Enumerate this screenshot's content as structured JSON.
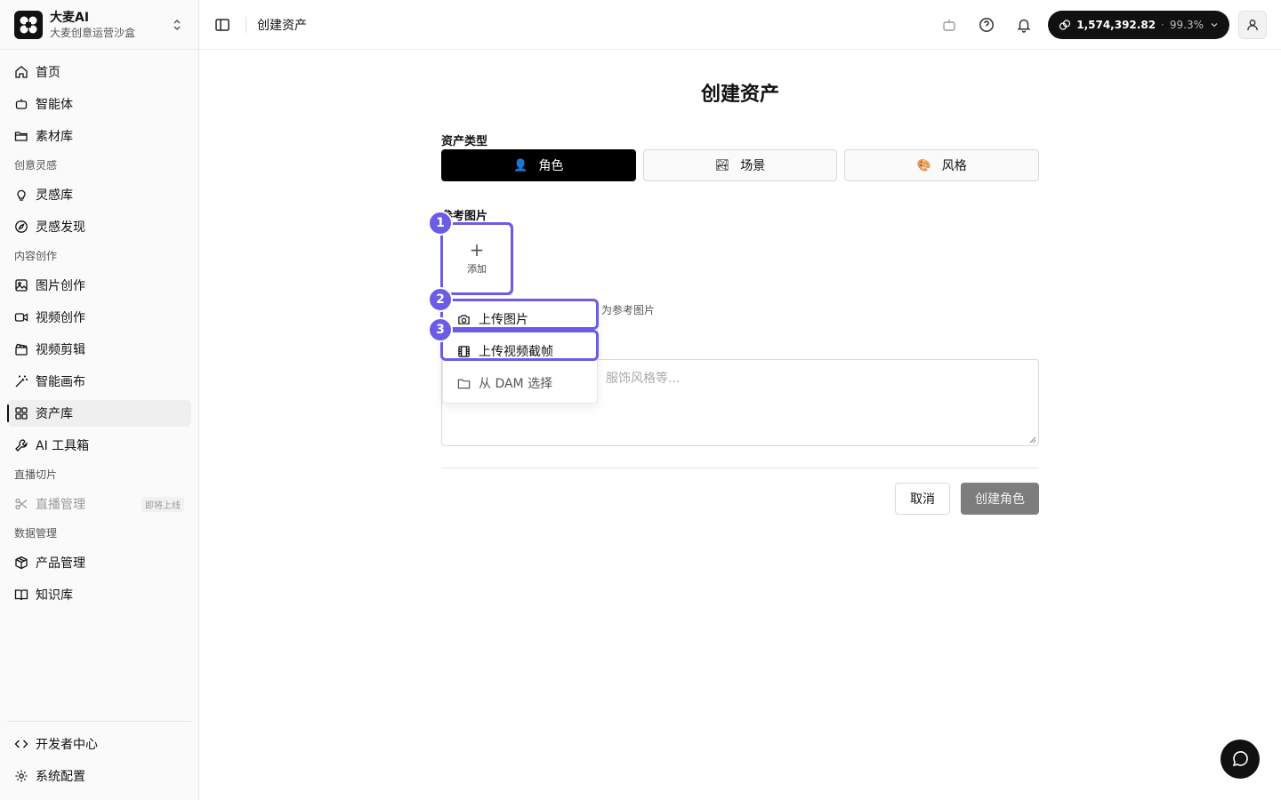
{
  "brand": {
    "name": "大麦AI",
    "subtitle": "大麦创意运营沙盒"
  },
  "nav": {
    "home": "首页",
    "agents": "智能体",
    "materials": "素材库",
    "group_creative": "创意灵感",
    "inspiration_lib": "灵感库",
    "inspiration_discover": "灵感发现",
    "group_content": "内容创作",
    "image_create": "图片创作",
    "video_create": "视频创作",
    "video_edit": "视频剪辑",
    "smart_canvas": "智能画布",
    "assets": "资产库",
    "ai_toolbox": "AI 工具箱",
    "group_live": "直播切片",
    "live_manage": "直播管理",
    "live_badge": "即将上线",
    "group_data": "数据管理",
    "product_manage": "产品管理",
    "knowledge": "知识库",
    "developer": "开发者中心",
    "settings": "系统配置"
  },
  "topbar": {
    "breadcrumb": "创建资产",
    "credits": "1,574,392.82",
    "credit_sep": "·",
    "credit_pct": "99.3%"
  },
  "form": {
    "title": "创建资产",
    "asset_type_label": "资产类型",
    "types": [
      {
        "label": "角色",
        "icon": "👤"
      },
      {
        "label": "场景",
        "icon": "🏞"
      },
      {
        "label": "风格",
        "icon": "🎨"
      }
    ],
    "ref_image_label": "参考图片",
    "add_label": "添加",
    "hint_text": "为参考图片",
    "desc_placeholder": "、服饰风格等...",
    "cancel": "取消",
    "submit": "创建角色"
  },
  "menu": {
    "upload_image": "上传图片",
    "upload_frame": "上传视频截帧",
    "from_dam": "从 DAM 选择"
  },
  "annotations": [
    "1",
    "2",
    "3"
  ],
  "colors": {
    "accent": "#6b5ce7",
    "primary": "#000000",
    "disabled_button": "#7d7d7d"
  }
}
